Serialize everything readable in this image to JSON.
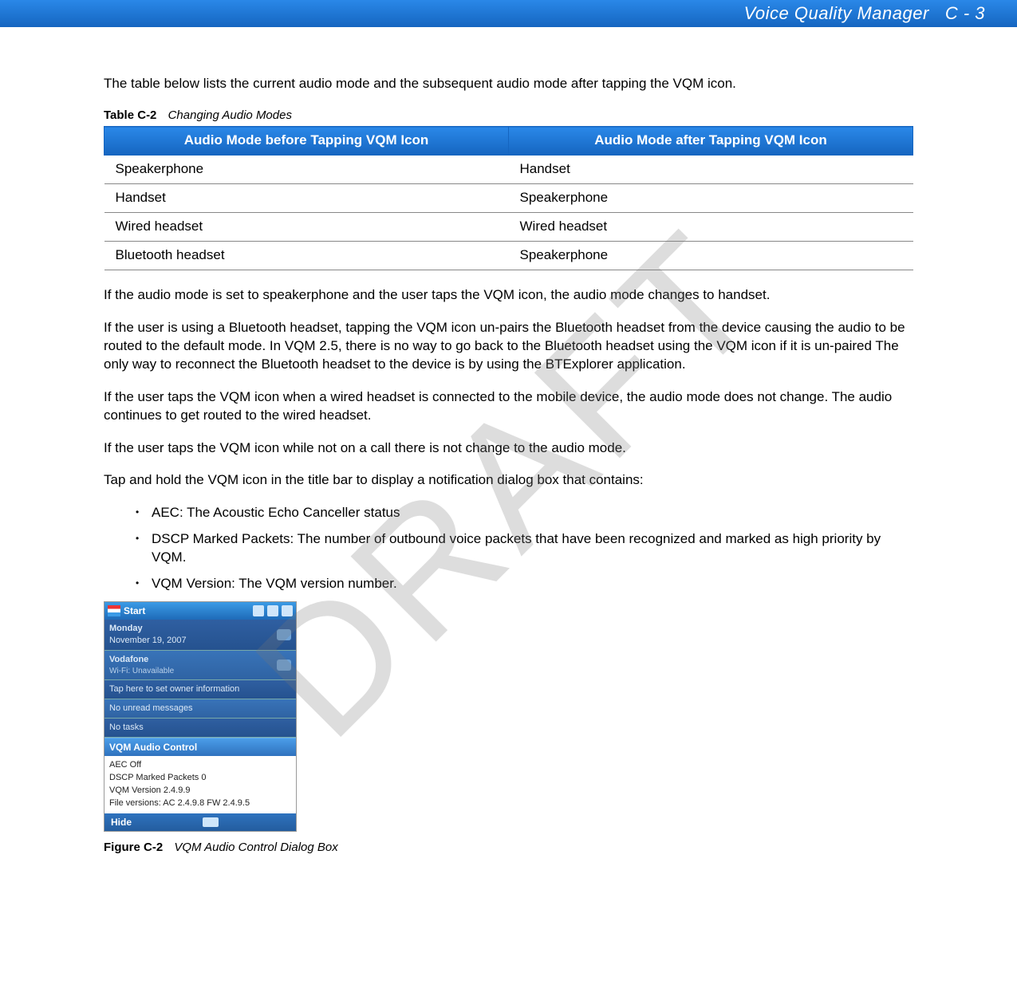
{
  "header": {
    "title": "Voice Quality Manager",
    "page": "C - 3"
  },
  "watermark": "DRAFT",
  "intro": "The table below lists the current audio mode and the subsequent audio mode after tapping the VQM icon.",
  "table": {
    "label": "Table C-2",
    "title": "Changing Audio Modes",
    "headers": [
      "Audio Mode before Tapping VQM Icon",
      "Audio Mode after Tapping VQM Icon"
    ],
    "rows": [
      [
        "Speakerphone",
        "Handset"
      ],
      [
        "Handset",
        "Speakerphone"
      ],
      [
        "Wired headset",
        "Wired headset"
      ],
      [
        "Bluetooth headset",
        "Speakerphone"
      ]
    ]
  },
  "paragraphs": {
    "p1": "If the audio mode is set to speakerphone and the user taps the VQM icon, the audio mode changes to handset.",
    "p2": "If the user is using a Bluetooth headset, tapping the VQM icon un-pairs the Bluetooth headset from the device causing the audio to be routed to the default mode. In VQM 2.5, there is no way to go back to the Bluetooth headset using the VQM icon if it is un-paired The only way to reconnect the Bluetooth headset to the device is by using the BTExplorer application.",
    "p3": "If the user taps the VQM icon when a wired headset is connected to the mobile device, the audio mode does not change. The audio continues to get routed to the wired headset.",
    "p4": "If the user taps the VQM icon while not on a call there is not change to the audio mode.",
    "p5": "Tap and hold the VQM icon in the title bar to display a notification dialog box that contains:"
  },
  "bullets": [
    "AEC: The Acoustic Echo Canceller status",
    "DSCP Marked Packets: The number of outbound voice packets that have been recognized and marked as high priority by VQM.",
    "VQM Version: The VQM version number."
  ],
  "screenshot": {
    "start": "Start",
    "day": "Monday",
    "date": "November 19, 2007",
    "carrier": "Vodafone",
    "wifi": "Wi-Fi: Unavailable",
    "owner": "Tap here to set owner information",
    "messages": "No unread messages",
    "tasks": "No tasks",
    "dialog_title": "VQM Audio Control",
    "aec": "AEC Off",
    "dscp": "DSCP Marked Packets 0",
    "version": "VQM Version 2.4.9.9",
    "fileversions": "File versions: AC 2.4.9.8 FW 2.4.9.5",
    "hide": "Hide"
  },
  "figure": {
    "label": "Figure C-2",
    "title": "VQM Audio Control Dialog Box"
  }
}
